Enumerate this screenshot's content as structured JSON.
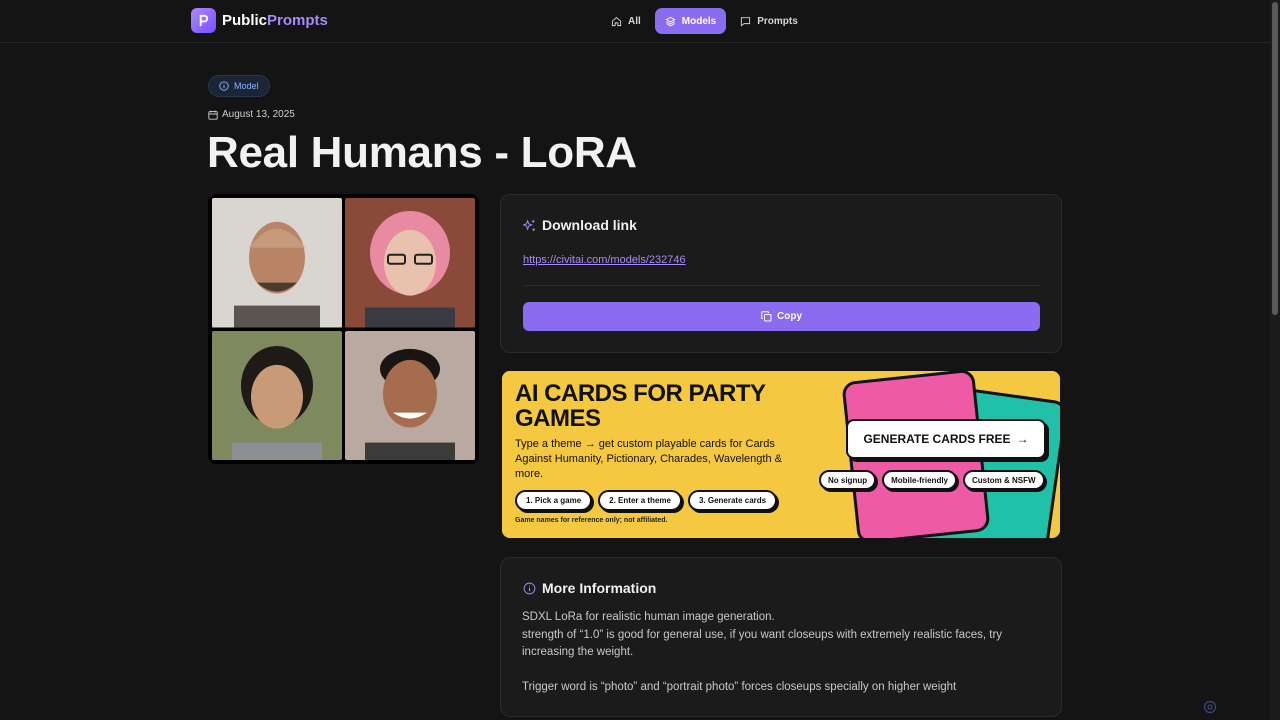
{
  "brand": {
    "name_part1": "Public",
    "name_part2": "Prompts"
  },
  "nav": {
    "items": [
      {
        "label": "All"
      },
      {
        "label": "Models"
      },
      {
        "label": "Prompts"
      }
    ]
  },
  "page": {
    "badge": "Model",
    "date": "August 13, 2025",
    "title": "Real Humans - LoRA"
  },
  "download": {
    "heading": "Download link",
    "url": "https://civitai.com/models/232746",
    "copy_label": "Copy"
  },
  "ad": {
    "title": "AI CARDS FOR PARTY GAMES",
    "description": "Type a theme → get custom playable cards for Cards Against Humanity, Pictionary, Charades, Wavelength & more.",
    "steps": [
      "1. Pick a game",
      "2. Enter a theme",
      "3. Generate cards"
    ],
    "note": "Game names for reference only; not affiliated.",
    "cta": "GENERATE CARDS FREE",
    "cta_arrow": "→",
    "tags": [
      "No signup",
      "Mobile-friendly",
      "Custom & NSFW"
    ]
  },
  "info": {
    "heading": "More Information",
    "lines": [
      "SDXL LoRa for realistic human image generation.",
      "strength of “1.0” is good for general use, if you want closeups with extremely realistic faces, try increasing the weight.",
      "",
      "Trigger word is “photo” and “portrait photo” forces closeups specially on higher weight"
    ]
  },
  "colors": {
    "accent": "#8b6cf0",
    "link": "#a78bfa",
    "ad_bg": "#f5c842",
    "badge_text": "#8fb4ff"
  }
}
